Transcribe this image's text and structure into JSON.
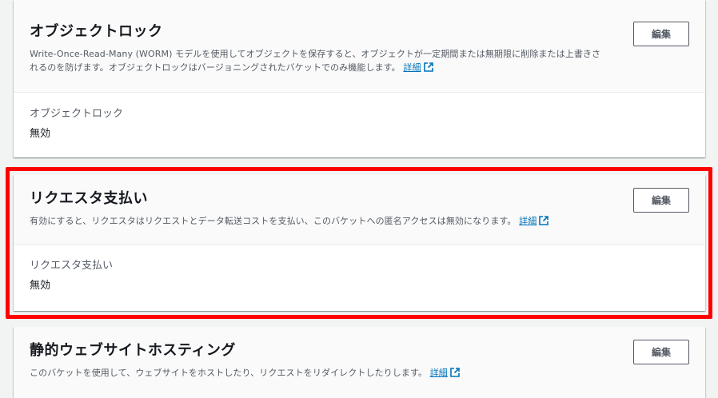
{
  "panels": [
    {
      "title": "オブジェクトロック",
      "desc": "Write-Once-Read-Many (WORM) モデルを使用してオブジェクトを保存すると、オブジェクトが一定期間または無期限に削除または上書きされるのを防げます。オブジェクトロックはバージョニングされたバケットでのみ機能します。",
      "link_label": "詳細",
      "edit_label": "編集",
      "field_label": "オブジェクトロック",
      "field_value": "無効"
    },
    {
      "title": "リクエスタ支払い",
      "desc": "有効にすると、リクエスタはリクエストとデータ転送コストを支払い、このバケットへの匿名アクセスは無効になります。",
      "link_label": "詳細",
      "edit_label": "編集",
      "field_label": "リクエスタ支払い",
      "field_value": "無効"
    },
    {
      "title": "静的ウェブサイトホスティング",
      "desc": "このバケットを使用して、ウェブサイトをホストしたり、リクエストをリダイレクトしたりします。",
      "link_label": "詳細",
      "edit_label": "編集"
    }
  ],
  "colors": {
    "link": "#0073bb",
    "highlight": "#ff0000",
    "background": "#f2f3f3"
  },
  "icons": {
    "external_link": "external-link-icon"
  }
}
